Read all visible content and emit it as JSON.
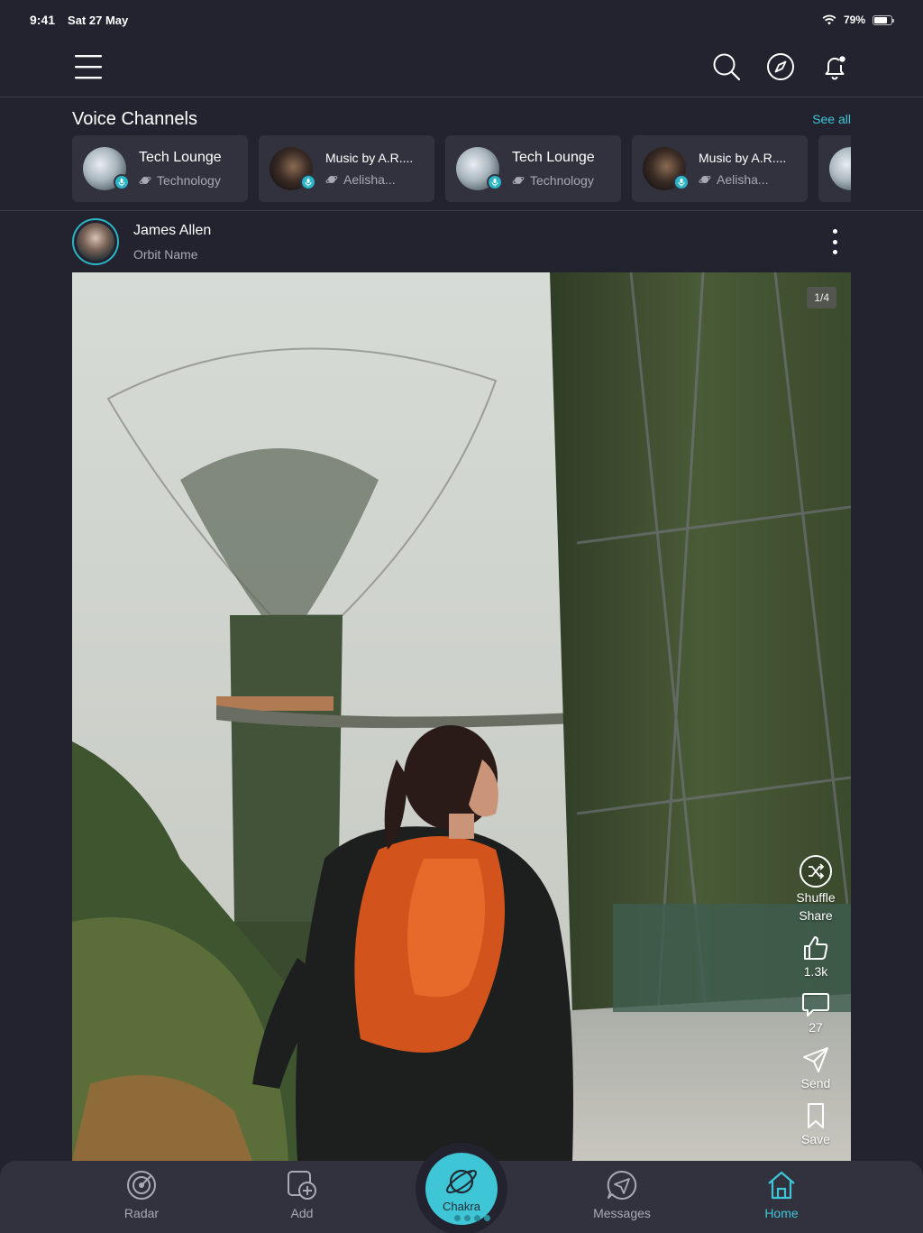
{
  "status_bar": {
    "time": "9:41",
    "date": "Sat 27 May",
    "battery": "79%",
    "battery_level": 0.79
  },
  "top_nav": {
    "icons": [
      "menu-icon",
      "search-icon",
      "compass-icon",
      "bell-icon"
    ]
  },
  "voice_channels": {
    "title": "Voice Channels",
    "see_all": "See all",
    "items": [
      {
        "name": "Tech Lounge",
        "sub": "Technology"
      },
      {
        "name": "Music by A.R....",
        "sub": "Aelisha..."
      },
      {
        "name": "Tech Lounge",
        "sub": "Technology"
      },
      {
        "name": "Music by A.R....",
        "sub": "Aelisha..."
      }
    ]
  },
  "post": {
    "author": "James Allen",
    "orbit": "Orbit Name",
    "image_counter": "1/4",
    "actions": {
      "shuffle_label": "Shuffle",
      "share_label": "Share",
      "likes": "1.3k",
      "comments": "27",
      "send_label": "Send",
      "save_label": "Save"
    }
  },
  "bottom_nav": {
    "radar": "Radar",
    "add": "Add",
    "chakra": "Chakra",
    "messages": "Messages",
    "home": "Home"
  },
  "colors": {
    "accent": "#3fc6d6",
    "background": "#23232f",
    "card": "#32323f"
  }
}
